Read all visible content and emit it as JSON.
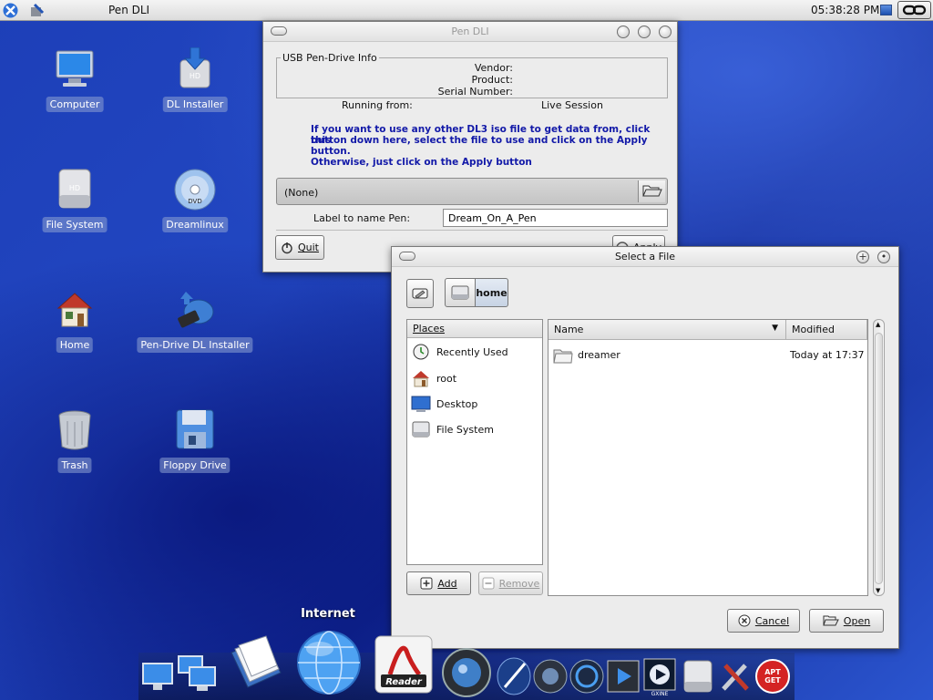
{
  "top_panel": {
    "active_window_title": "Pen DLI",
    "clock": "05:38:28 PM"
  },
  "desktop_icons": [
    {
      "label": "Computer",
      "icon": "computer-icon"
    },
    {
      "label": "DL Installer",
      "icon": "installer-drive-icon"
    },
    {
      "label": "File System",
      "icon": "hard-disk-icon"
    },
    {
      "label": "Dreamlinux",
      "icon": "dvd-icon"
    },
    {
      "label": "Home",
      "icon": "home-icon"
    },
    {
      "label": "Pen-Drive DL Installer",
      "icon": "usb-drive-icon"
    },
    {
      "label": "Trash",
      "icon": "trash-icon"
    },
    {
      "label": "Floppy Drive",
      "icon": "floppy-icon"
    }
  ],
  "pen_dli": {
    "title": "Pen DLI",
    "group_title": "USB Pen-Drive Info",
    "vendor_label": "Vendor:",
    "product_label": "Product:",
    "serial_label": "Serial Number:",
    "running_from_label": "Running from:",
    "running_from_value": "Live Session",
    "notice_line1": "If you want to use any other DL3 iso file to get data from, click this",
    "notice_line2": "button down here, select the file to use and click on the Apply button.",
    "notice_line3": "Otherwise, just click on the Apply button",
    "iso_file_value": "(None)",
    "pen_name_label": "Label to name Pen:",
    "pen_name_value": "Dream_On_A_Pen",
    "quit_label": "Quit",
    "apply_label": "Apply"
  },
  "file_chooser": {
    "title": "Select a File",
    "crumb_current": "home",
    "places_header": "Places",
    "places": [
      {
        "label": "Recently Used",
        "icon": "recent-icon"
      },
      {
        "label": "root",
        "icon": "home-icon"
      },
      {
        "label": "Desktop",
        "icon": "desktop-icon"
      },
      {
        "label": "File System",
        "icon": "hard-disk-icon"
      }
    ],
    "add_label": "Add",
    "remove_label": "Remove",
    "col_name": "Name",
    "col_modified": "Modified",
    "files": [
      {
        "name": "dreamer",
        "modified": "Today at 17:37",
        "icon": "folder-icon"
      }
    ],
    "cancel_label": "Cancel",
    "open_label": "Open"
  },
  "dock": {
    "hover_label": "Internet",
    "items": [
      "monitor-icon",
      "network-icon",
      "documents-icon",
      "internet-globe-icon",
      "adobe-reader-icon",
      "camera-lens-icon",
      "inkscape-pen-icon",
      "audio-speaker-icon",
      "media-player-icon",
      "xine-player-icon",
      "gxine-icon",
      "hard-disk-icon",
      "tools-icon",
      "apt-get-icon"
    ]
  },
  "colors": {
    "desktop_blue": "#1d3fb8",
    "notice_text": "#1219a8"
  }
}
